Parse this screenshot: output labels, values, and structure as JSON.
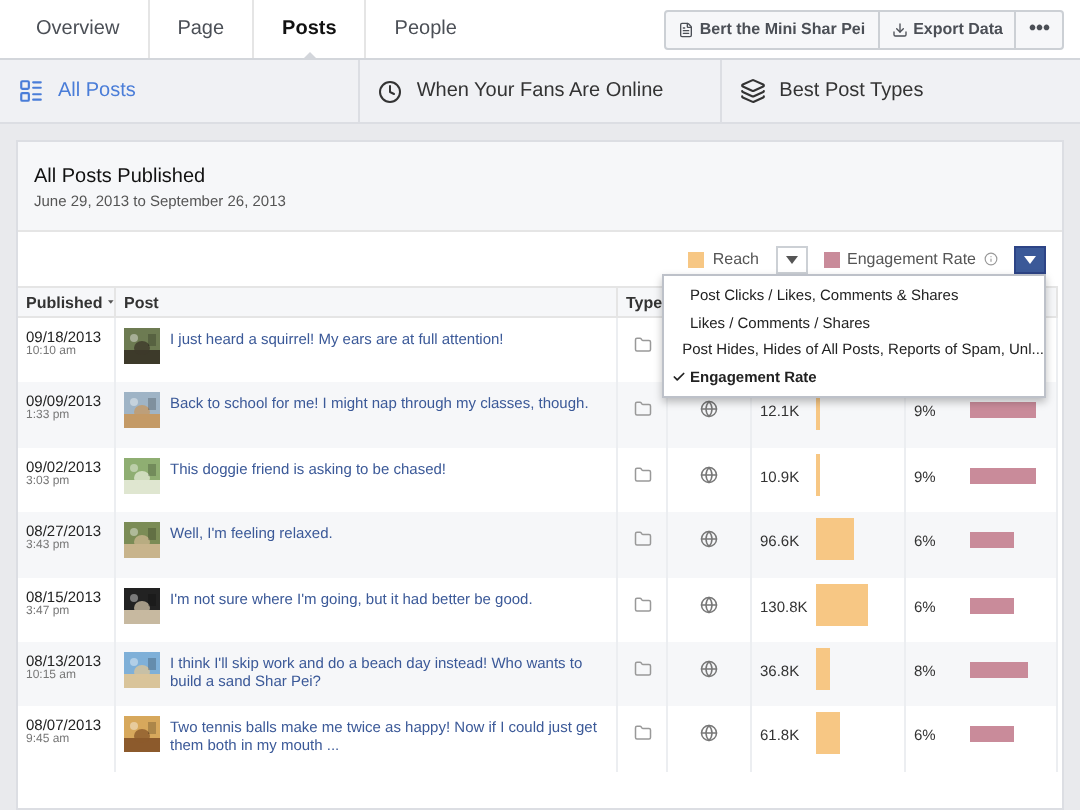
{
  "nav": {
    "tabs": [
      {
        "label": "Overview",
        "selected": false
      },
      {
        "label": "Page",
        "selected": false
      },
      {
        "label": "Posts",
        "selected": true
      },
      {
        "label": "People",
        "selected": false
      }
    ],
    "page_button": "Bert the Mini Shar Pei",
    "export_button": "Export Data",
    "more_button": "•••"
  },
  "subtabs": [
    {
      "label": "All Posts",
      "selected": true,
      "kind": "list"
    },
    {
      "label": "When Your Fans Are Online",
      "selected": false,
      "kind": "clock"
    },
    {
      "label": "Best Post Types",
      "selected": false,
      "kind": "stack"
    }
  ],
  "card": {
    "title": "All Posts Published",
    "date_range": "June 29, 2013 to September 26, 2013"
  },
  "legend": [
    {
      "label": "Reach",
      "color": "#f7c784",
      "kind": "plain",
      "expanded": false
    },
    {
      "label": "Engagement Rate",
      "color": "#c98b9a",
      "kind": "info",
      "expanded": true
    }
  ],
  "menu": [
    {
      "label": "Post Clicks / Likes, Comments & Shares",
      "selected": false
    },
    {
      "label": "Likes / Comments / Shares",
      "selected": false
    },
    {
      "label": "Post Hides, Hides of All Posts, Reports of Spam, Unl...",
      "selected": false
    },
    {
      "label": "Engagement Rate",
      "selected": true
    }
  ],
  "columns": [
    "Published",
    "Post",
    "Type"
  ],
  "rows": [
    {
      "date": "09/18/2013",
      "time": "10:10 am",
      "text": "I just heard a squirrel! My ears are at full attention!"
    },
    {
      "date": "09/09/2013",
      "time": "1:33 pm",
      "text": "Back to school for me! I might nap through my classes, though.",
      "reach": "12.1K",
      "engagement": "9%"
    },
    {
      "date": "09/02/2013",
      "time": "3:03 pm",
      "text": "This doggie friend is asking to be chased!",
      "reach": "10.9K",
      "engagement": "9%"
    },
    {
      "date": "08/27/2013",
      "time": "3:43 pm",
      "text": "Well, I'm feeling relaxed.",
      "reach": "96.6K",
      "engagement": "6%"
    },
    {
      "date": "08/15/2013",
      "time": "3:47 pm",
      "text": "I'm not sure where I'm going, but it had better be good.",
      "reach": "130.8K",
      "engagement": "6%"
    },
    {
      "date": "08/13/2013",
      "time": "10:15 am",
      "text": "I think I'll skip work and do a beach day instead! Who wants to build a sand Shar Pei?",
      "reach": "36.8K",
      "engagement": "8%"
    },
    {
      "date": "08/07/2013",
      "time": "9:45 am",
      "text": "Two tennis balls make me twice as happy! Now if I could just get them both in my mouth ...",
      "reach": "61.8K",
      "engagement": "6%"
    }
  ]
}
